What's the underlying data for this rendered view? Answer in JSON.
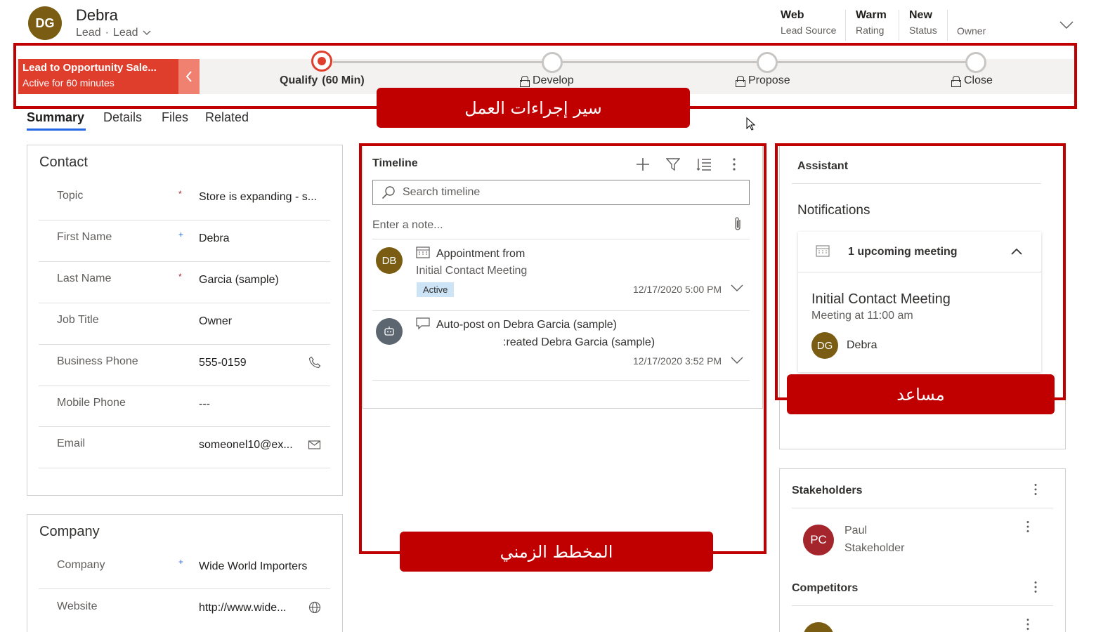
{
  "header": {
    "avatar_initials": "DG",
    "avatar_color": "#7a5c12",
    "record_name": "Debra",
    "entity": "Lead",
    "form_name": "Lead",
    "dot_separator": "·",
    "fields": [
      {
        "value": "Web",
        "label": "Lead Source"
      },
      {
        "value": "Warm",
        "label": "Rating"
      },
      {
        "value": "New",
        "label": "Status"
      },
      {
        "value": "",
        "label": "Owner"
      }
    ]
  },
  "bpf": {
    "process_name": "Lead to Opportunity Sale...",
    "active_for": "Active for 60 minutes",
    "accent_color": "#e03e2d",
    "stages": [
      {
        "name": "Qualify",
        "detail": "(60 Min)",
        "active": true,
        "locked": false
      },
      {
        "name": "Develop",
        "detail": "",
        "active": false,
        "locked": true
      },
      {
        "name": "Propose",
        "detail": "",
        "active": false,
        "locked": true
      },
      {
        "name": "Close",
        "detail": "",
        "active": false,
        "locked": true
      }
    ]
  },
  "annotations": {
    "bpf_label": "سير إجراءات العمل",
    "timeline_label": "المخطط الزمني",
    "assistant_label": "مساعد",
    "color": "#c00000"
  },
  "tabs": [
    "Summary",
    "Details",
    "Files",
    "Related"
  ],
  "contact": {
    "title": "Contact",
    "fields": [
      {
        "label": "Topic",
        "marker": "*",
        "value": "Store is expanding - s...",
        "icon": ""
      },
      {
        "label": "First Name",
        "marker": "+",
        "value": "Debra",
        "icon": ""
      },
      {
        "label": "Last Name",
        "marker": "*",
        "value": "Garcia (sample)",
        "icon": ""
      },
      {
        "label": "Job Title",
        "marker": "",
        "value": "Owner",
        "icon": ""
      },
      {
        "label": "Business Phone",
        "marker": "",
        "value": "555-0159",
        "icon": "phone-icon"
      },
      {
        "label": "Mobile Phone",
        "marker": "",
        "value": "---",
        "icon": ""
      },
      {
        "label": "Email",
        "marker": "",
        "value": "someonel10@ex...",
        "icon": "email-icon"
      }
    ]
  },
  "company": {
    "title": "Company",
    "fields": [
      {
        "label": "Company",
        "marker": "+",
        "value": "Wide World Importers",
        "icon": ""
      },
      {
        "label": "Website",
        "marker": "",
        "value": "http://www.wide...",
        "icon": "globe-icon"
      }
    ]
  },
  "timeline": {
    "title": "Timeline",
    "search_placeholder": "Search timeline",
    "note_placeholder": "Enter a note...",
    "items": [
      {
        "avatar": "DB",
        "title": "Appointment from",
        "subtitle": "Initial Contact Meeting",
        "badge": "Active",
        "timestamp": "12/17/2020 5:00 PM"
      },
      {
        "avatar": "",
        "title": "Auto-post on Debra Garcia (sample)",
        "subtitle_prefix": ":reated",
        "subtitle_strong": "Debra Garcia (sample)",
        "timestamp": "12/17/2020 3:52 PM"
      }
    ]
  },
  "assistant": {
    "title": "Assistant",
    "notifications_title": "Notifications",
    "summary": "1 upcoming meeting",
    "meeting_title": "Initial Contact Meeting",
    "meeting_time": "Meeting at 11:00 am",
    "person_initials": "DG",
    "person_name": "Debra"
  },
  "stakeholders": {
    "title": "Stakeholders",
    "items": [
      {
        "initials": "PC",
        "name": "Paul",
        "role": "Stakeholder",
        "color": "#a4262c"
      }
    ]
  },
  "competitors": {
    "title": "Competitors"
  }
}
